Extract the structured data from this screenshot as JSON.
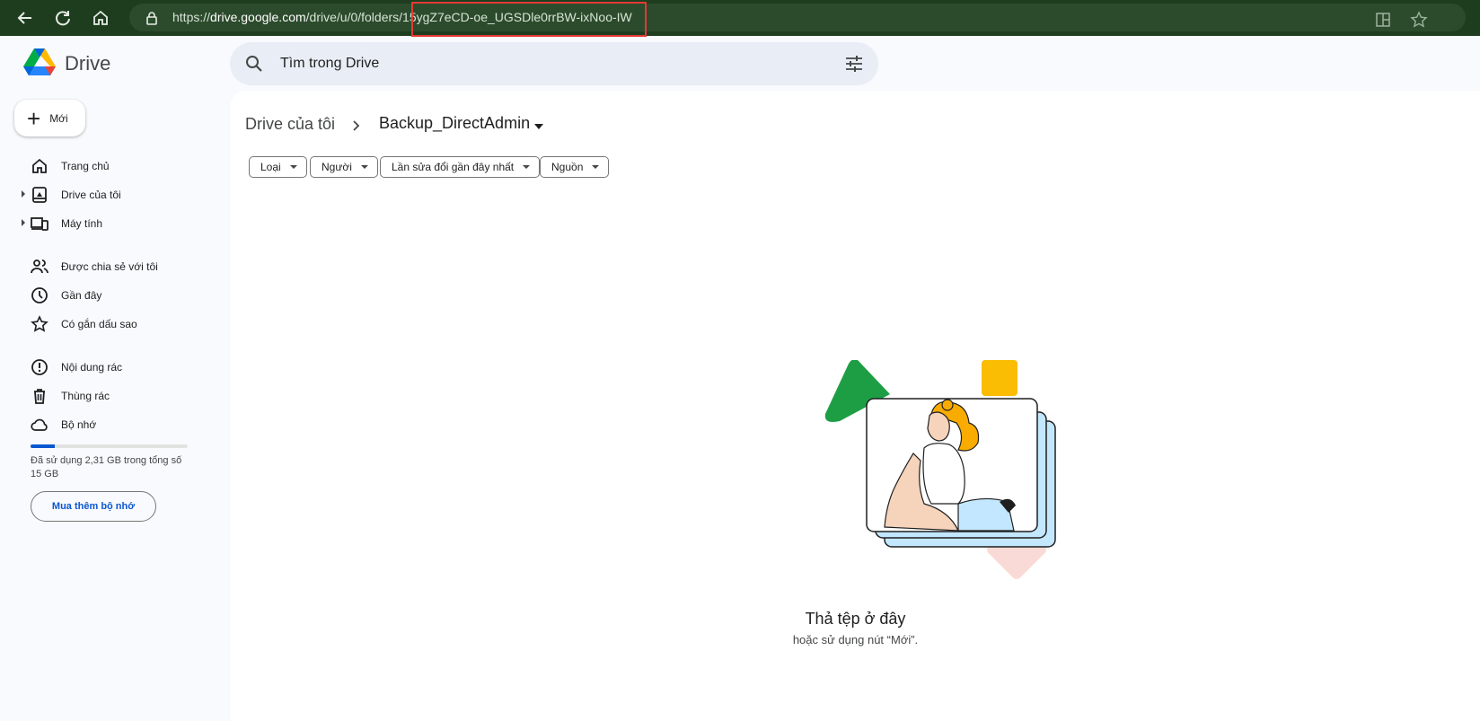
{
  "browser": {
    "url_prefix": "https://",
    "url_host": "drive.google.com",
    "url_path": "/drive/u/0/folders/15ygZ7eCD-oe_UGSDle0rrBW-ixNoo-IW"
  },
  "app": {
    "name": "Drive"
  },
  "new_button": {
    "label": "Mới"
  },
  "search": {
    "placeholder": "Tìm trong Drive"
  },
  "sidebar": {
    "items": [
      {
        "label": "Trang chủ",
        "icon": "home-icon"
      },
      {
        "label": "Drive của tôi",
        "icon": "my-drive-icon"
      },
      {
        "label": "Máy tính",
        "icon": "computers-icon"
      },
      {
        "label": "Được chia sẻ với tôi",
        "icon": "shared-icon"
      },
      {
        "label": "Gần đây",
        "icon": "clock-icon"
      },
      {
        "label": "Có gắn dấu sao",
        "icon": "star-icon"
      },
      {
        "label": "Nội dung rác",
        "icon": "spam-icon"
      },
      {
        "label": "Thùng rác",
        "icon": "trash-icon"
      },
      {
        "label": "Bộ nhớ",
        "icon": "cloud-icon"
      }
    ],
    "storage": {
      "used_fraction": 0.154,
      "text": "Đã sử dụng 2,31 GB trong tổng số 15 GB",
      "buy_label": "Mua thêm bộ nhớ"
    }
  },
  "breadcrumb": {
    "root": "Drive của tôi",
    "current": "Backup_DirectAdmin"
  },
  "filters": [
    "Loại",
    "Người",
    "Lần sửa đổi gần đây nhất",
    "Nguồn"
  ],
  "empty_state": {
    "title": "Thả tệp ở đây",
    "subtitle": "hoặc sử dụng nút “Mới”."
  },
  "colors": {
    "accent": "#0b57d0",
    "browser_bar": "#1e3d1f",
    "highlight": "#e53935"
  }
}
